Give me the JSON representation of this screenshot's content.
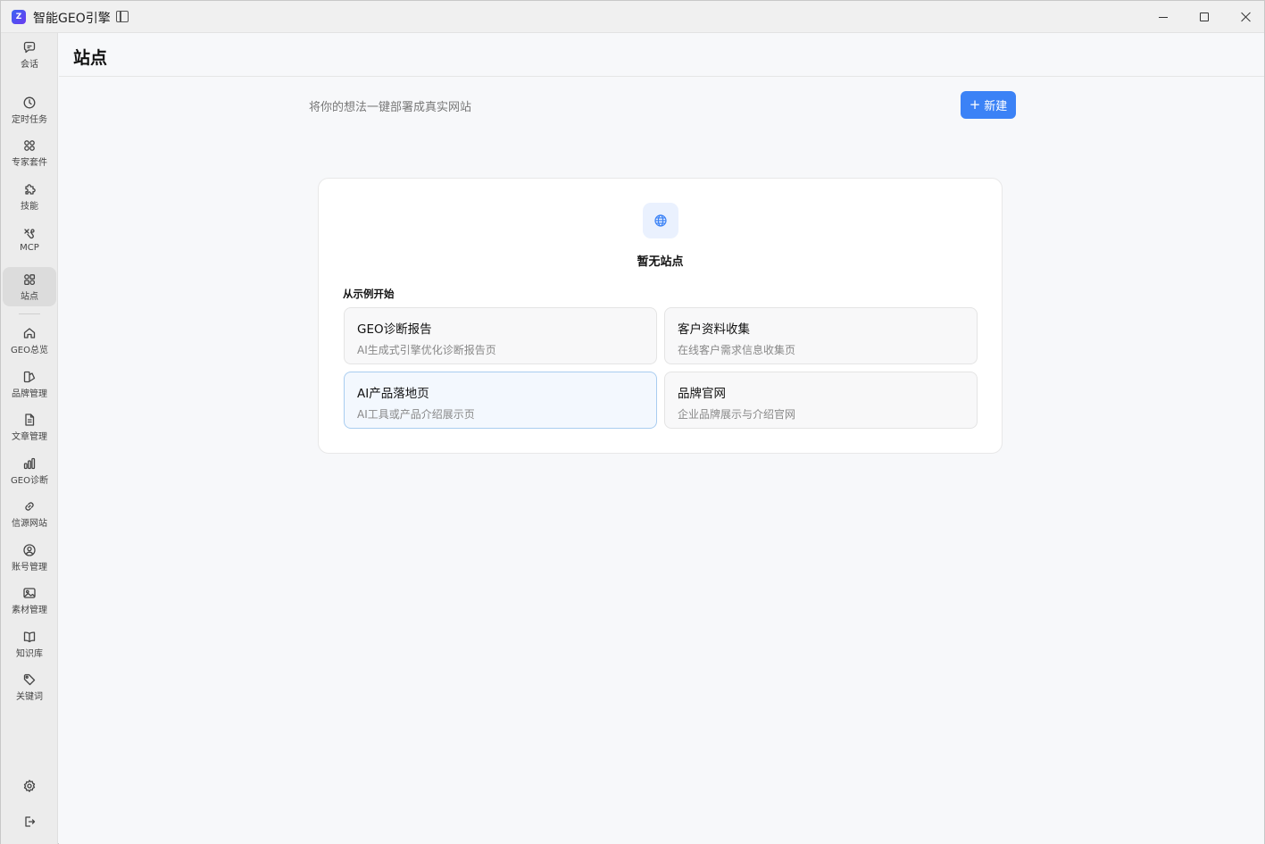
{
  "window": {
    "app_title": "智能GEO引擎",
    "logo_text": "Z"
  },
  "nav": {
    "items": [
      {
        "label": "会话",
        "icon": "chat-icon"
      },
      {
        "label": "定时任务",
        "icon": "clock-icon"
      },
      {
        "label": "专家套件",
        "icon": "grid-icon"
      },
      {
        "label": "技能",
        "icon": "puzzle-icon"
      },
      {
        "label": "MCP",
        "icon": "mcp-icon"
      },
      {
        "label": "站点",
        "icon": "sites-icon",
        "active": true
      },
      {
        "label": "GEO总览",
        "icon": "home-icon"
      },
      {
        "label": "品牌管理",
        "icon": "brand-icon"
      },
      {
        "label": "文章管理",
        "icon": "document-icon"
      },
      {
        "label": "GEO诊断",
        "icon": "bar-chart-icon"
      },
      {
        "label": "信源网站",
        "icon": "link-icon"
      },
      {
        "label": "账号管理",
        "icon": "user-circle-icon"
      },
      {
        "label": "素材管理",
        "icon": "image-icon"
      },
      {
        "label": "知识库",
        "icon": "book-icon"
      },
      {
        "label": "关键词",
        "icon": "tag-icon"
      }
    ],
    "bottom": [
      {
        "icon": "gear-icon"
      },
      {
        "icon": "logout-icon"
      }
    ]
  },
  "page": {
    "title": "站点",
    "subtitle": "将你的想法一键部署成真实网站",
    "new_button": "新建"
  },
  "empty": {
    "title": "暂无站点",
    "icon": "globe-icon"
  },
  "examples": {
    "label": "从示例开始",
    "templates": [
      {
        "title": "GEO诊断报告",
        "desc": "AI生成式引擎优化诊断报告页"
      },
      {
        "title": "客户资料收集",
        "desc": "在线客户需求信息收集页"
      },
      {
        "title": "AI产品落地页",
        "desc": "AI工具或产品介绍展示页"
      },
      {
        "title": "品牌官网",
        "desc": "企业品牌展示与介绍官网"
      }
    ]
  },
  "colors": {
    "accent": "#3b82f6",
    "active_nav_bg": "#dcdcdc",
    "highlight_border": "#a9cdf0"
  }
}
